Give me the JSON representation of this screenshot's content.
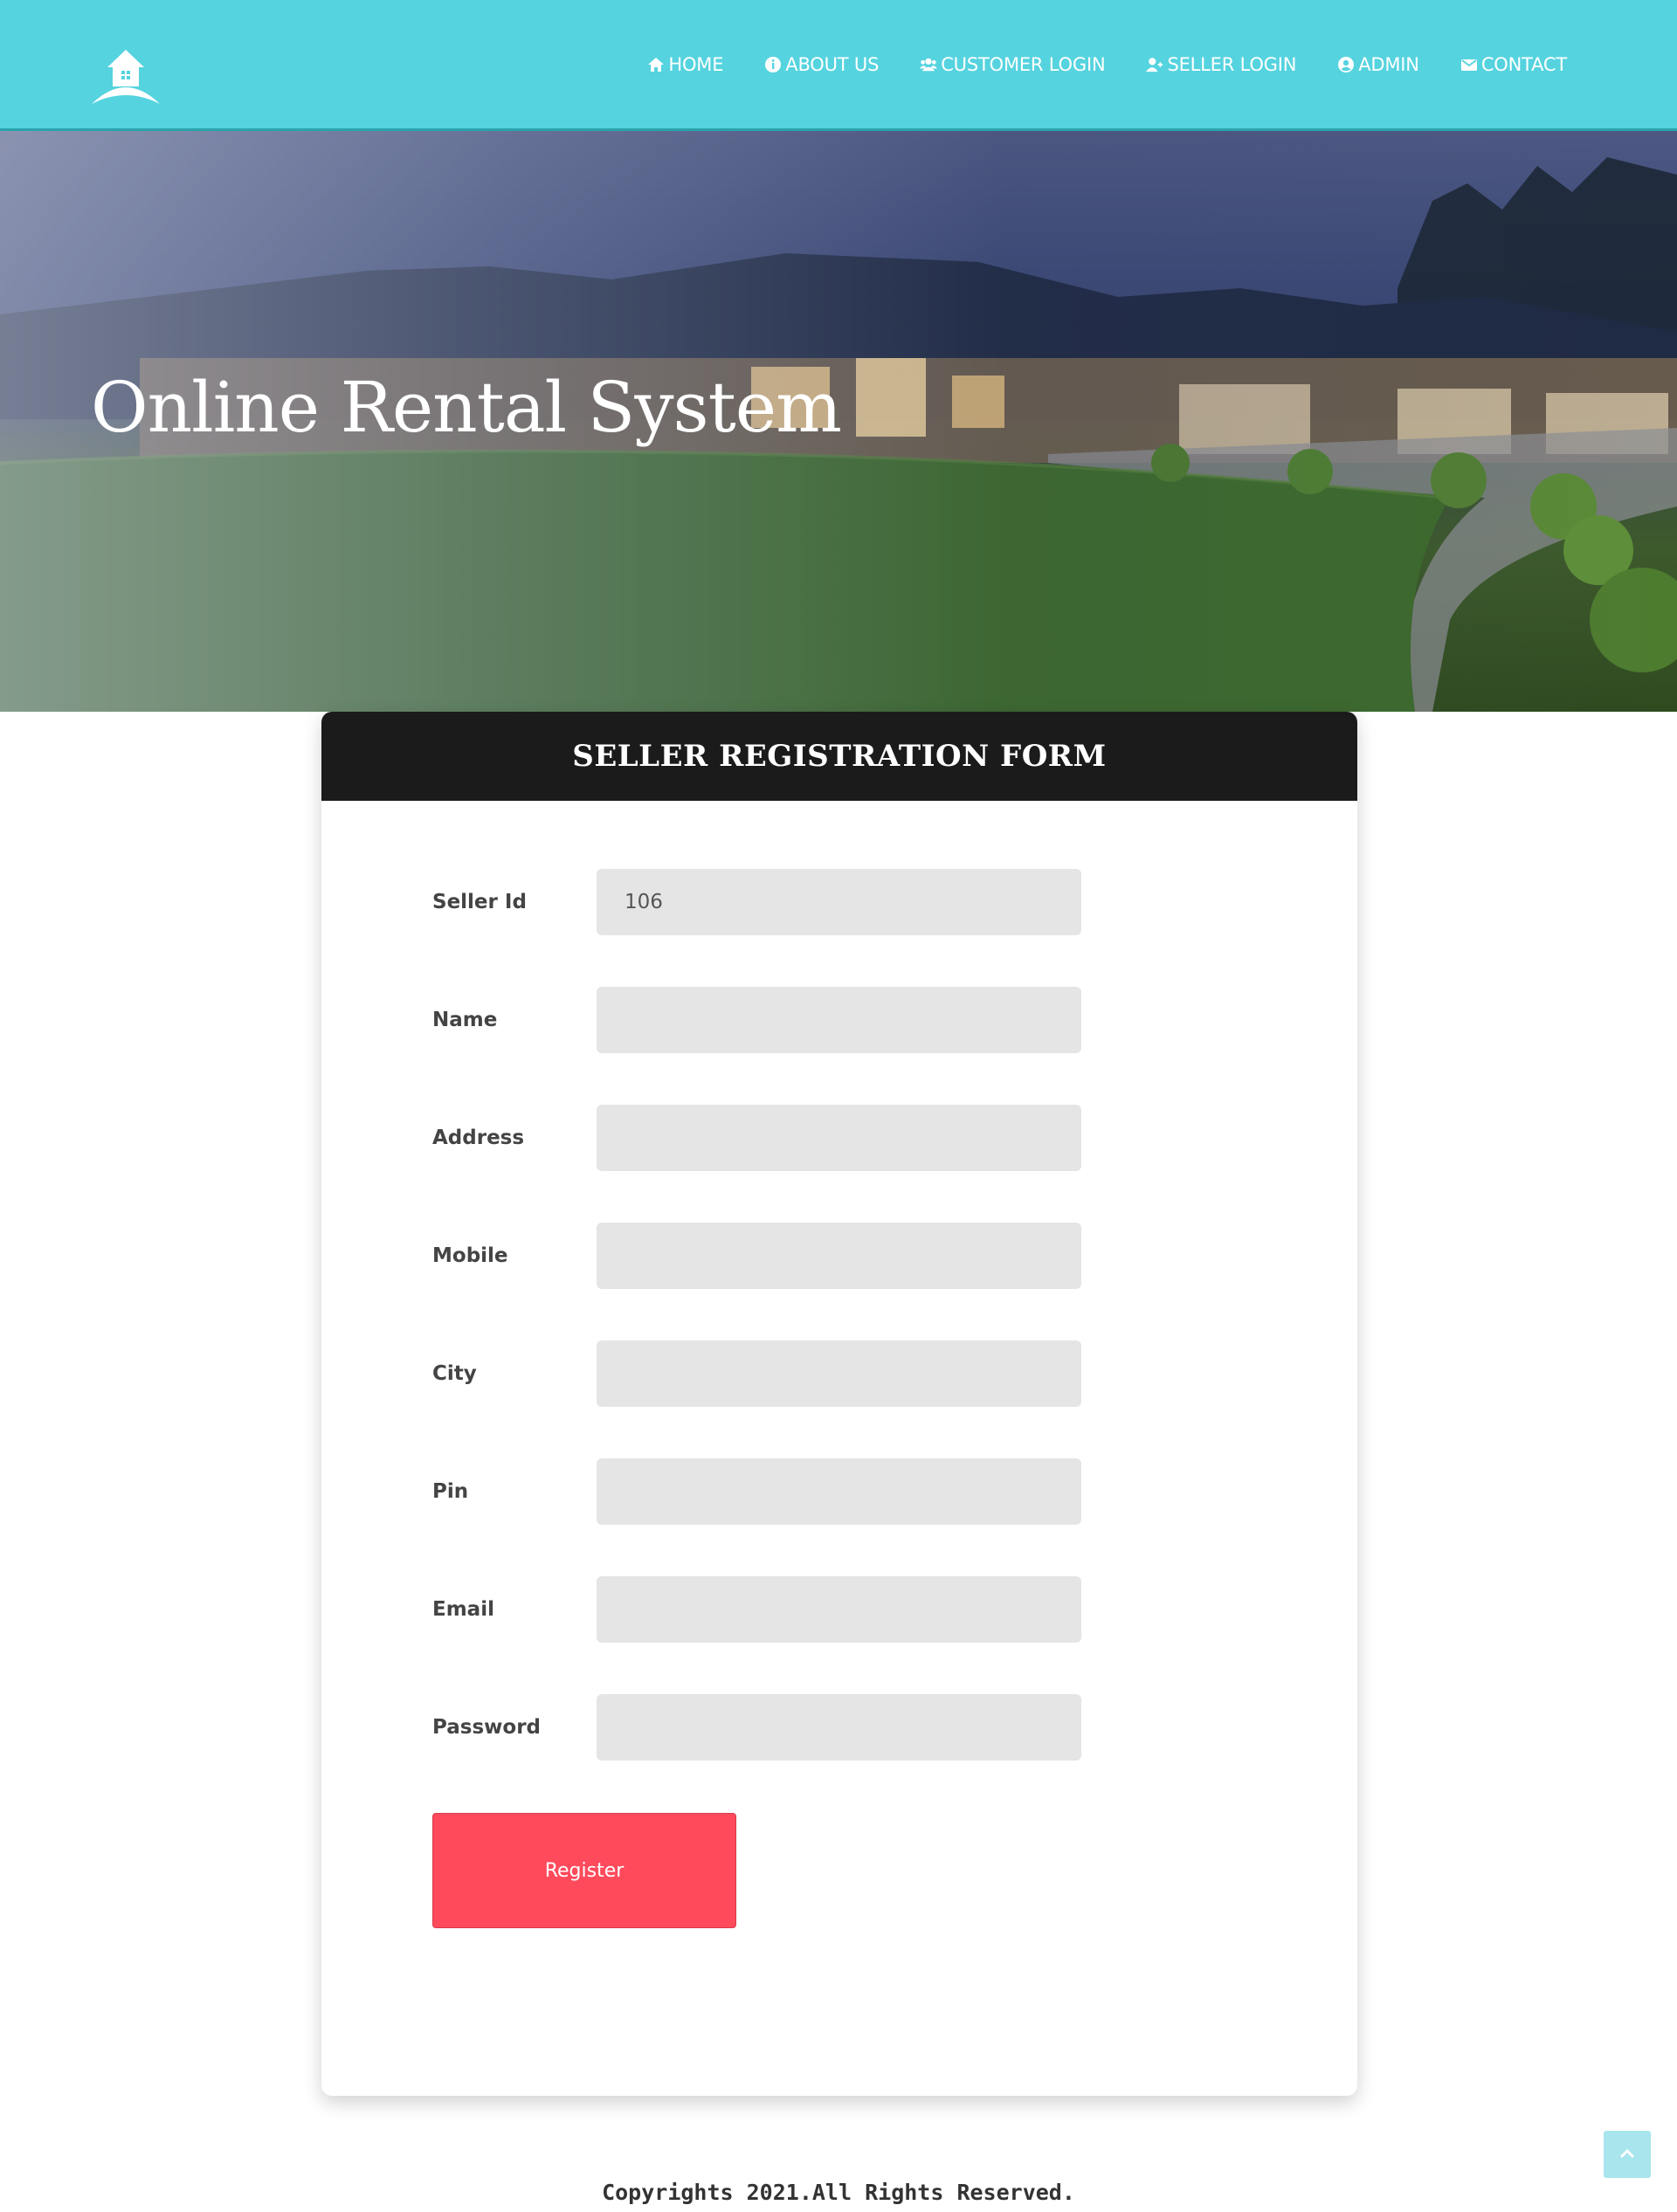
{
  "nav": {
    "items": [
      {
        "label": "HOME",
        "icon": "home-icon"
      },
      {
        "label": "ABOUT US",
        "icon": "info-icon"
      },
      {
        "label": "CUSTOMER LOGIN",
        "icon": "users-icon"
      },
      {
        "label": "SELLER LOGIN",
        "icon": "user-plus-icon"
      },
      {
        "label": "ADMIN",
        "icon": "user-circle-icon"
      },
      {
        "label": "CONTACT",
        "icon": "envelope-icon"
      }
    ]
  },
  "hero": {
    "title": "Online Rental System"
  },
  "form": {
    "title": "SELLER REGISTRATION FORM",
    "fields": [
      {
        "label": "Seller Id",
        "value": "106"
      },
      {
        "label": "Name",
        "value": ""
      },
      {
        "label": "Address",
        "value": ""
      },
      {
        "label": "Mobile",
        "value": ""
      },
      {
        "label": "City",
        "value": ""
      },
      {
        "label": "Pin",
        "value": ""
      },
      {
        "label": "Email",
        "value": ""
      },
      {
        "label": "Password",
        "value": ""
      }
    ],
    "submit_label": "Register"
  },
  "footer": {
    "text": "Copyrights 2021.All Rights Reserved."
  },
  "colors": {
    "navbar": "#55d3df",
    "header": "#1b1b1b",
    "button": "#ff4a5c"
  }
}
